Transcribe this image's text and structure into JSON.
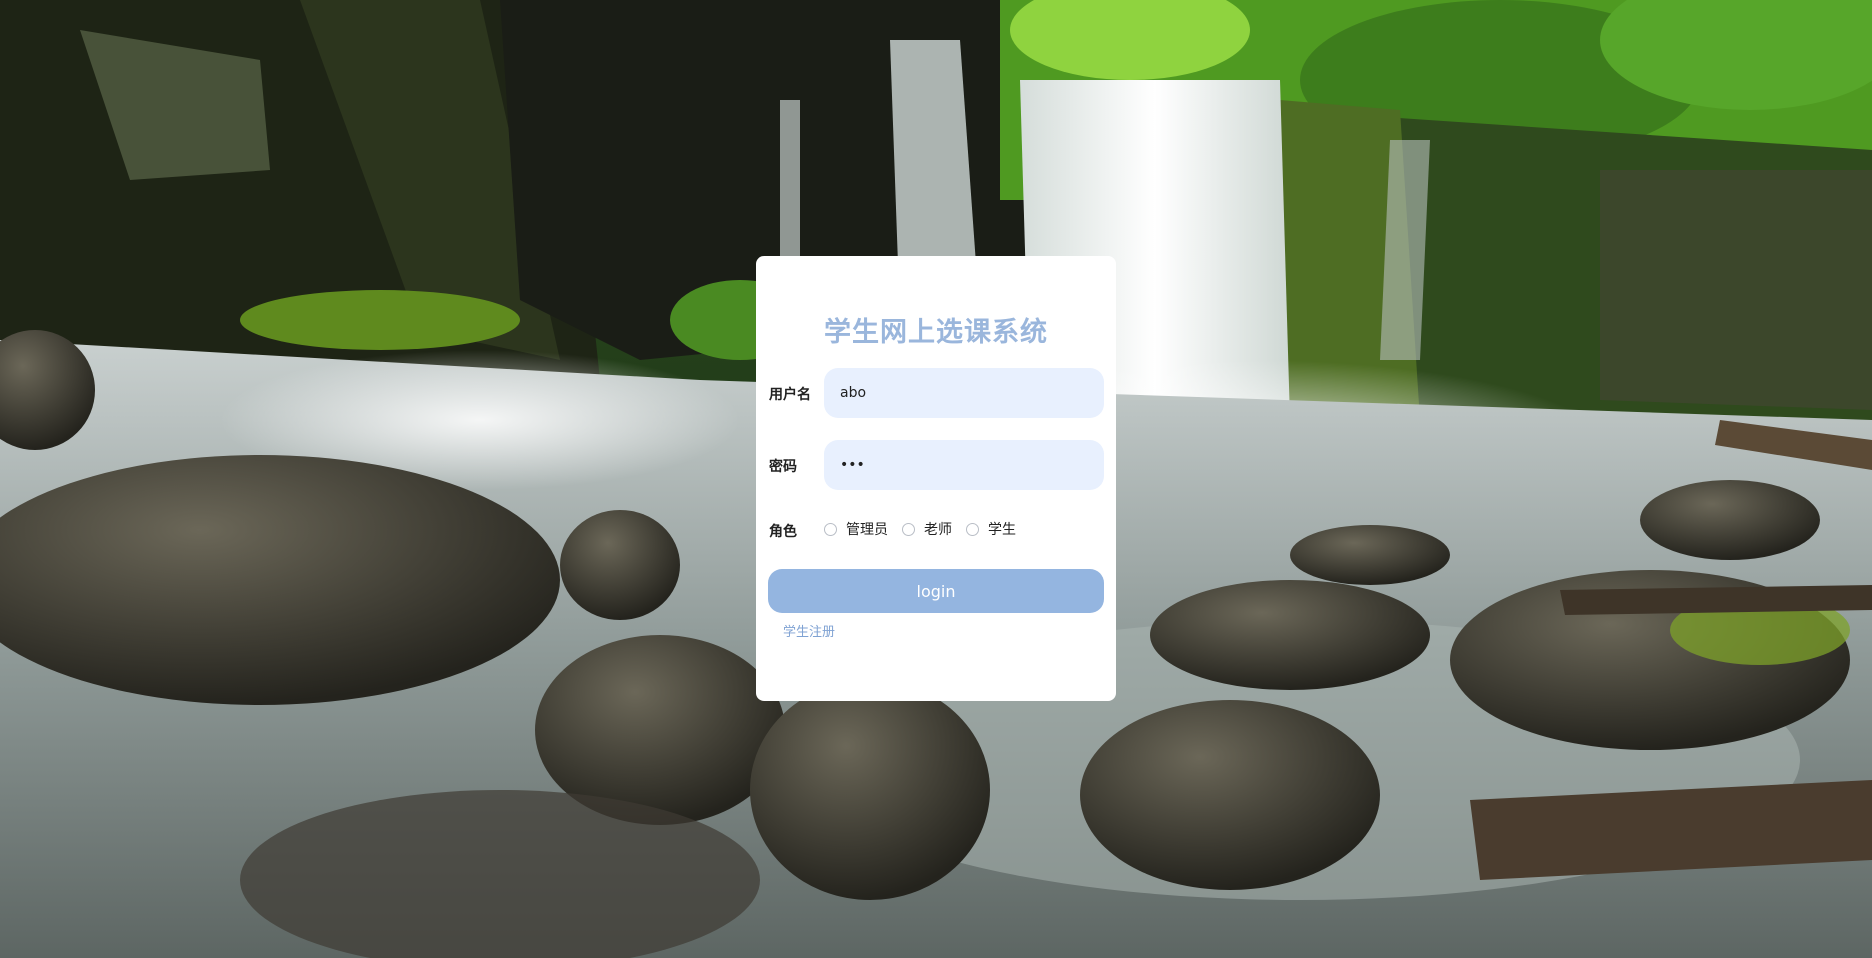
{
  "background": {
    "scene": "forest waterfall with mossy rocks and stream"
  },
  "login": {
    "title": "学生网上选课系统",
    "username_label": "用户名",
    "username_value": "abo",
    "password_label": "密码",
    "password_value": "abc",
    "role_label": "角色",
    "roles": [
      "管理员",
      "老师",
      "学生"
    ],
    "login_button": "login",
    "register_link": "学生注册"
  },
  "colors": {
    "accent": "#94b5e0",
    "title": "#9ab6dc",
    "input_bg": "#e8f0fe",
    "link": "#7fa2d3"
  }
}
